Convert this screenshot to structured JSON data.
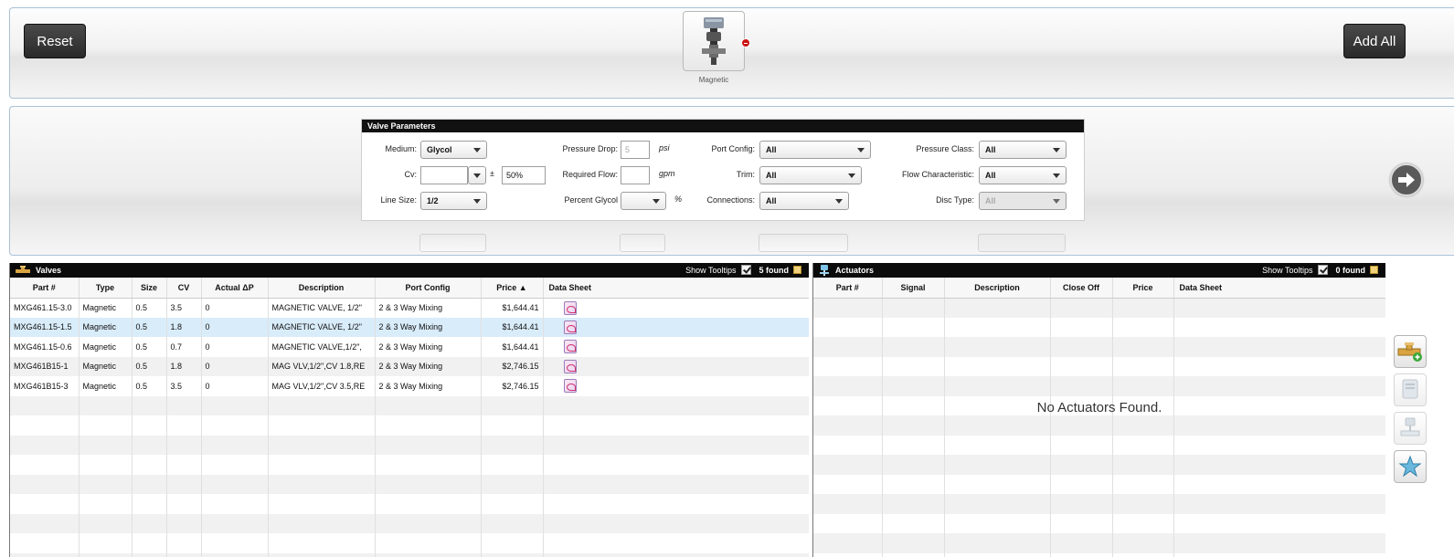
{
  "toolbar": {
    "reset_label": "Reset",
    "add_all_label": "Add All",
    "selected_valve_label": "Magnetic"
  },
  "params": {
    "title": "Valve Parameters",
    "medium_label": "Medium:",
    "medium_value": "Glycol",
    "cv_label": "Cv:",
    "cv_value": "",
    "plus_minus": "±",
    "cv_tolerance": "50%",
    "line_size_label": "Line Size:",
    "line_size_value": "1/2",
    "pressure_drop_label": "Pressure Drop:",
    "pressure_drop_placeholder": "5",
    "pressure_drop_unit": "psi",
    "required_flow_label": "Required Flow:",
    "required_flow_value": "",
    "required_flow_unit": "gpm",
    "percent_glycol_label": "Percent Glycol",
    "percent_glycol_value": "",
    "percent_unit": "%",
    "port_config_label": "Port Config:",
    "port_config_value": "All",
    "trim_label": "Trim:",
    "trim_value": "All",
    "connections_label": "Connections:",
    "connections_value": "All",
    "pressure_class_label": "Pressure Class:",
    "pressure_class_value": "All",
    "flow_char_label": "Flow Characteristic:",
    "flow_char_value": "All",
    "disc_type_label": "Disc Type:",
    "disc_type_value": "All"
  },
  "valves": {
    "title": "Valves",
    "show_tooltips_label": "Show Tooltips",
    "found_label": "5 found",
    "columns": [
      "Part #",
      "Type",
      "Size",
      "CV",
      "Actual ΔP",
      "Description",
      "Port Config",
      "Price ▲",
      "Data Sheet"
    ],
    "rows": [
      [
        "MXG461.15-3.0",
        "Magnetic",
        "0.5",
        "3.5",
        "0",
        "MAGNETIC VALVE, 1/2\"",
        "2 & 3 Way Mixing",
        "$1,644.41"
      ],
      [
        "MXG461.15-1.5",
        "Magnetic",
        "0.5",
        "1.8",
        "0",
        "MAGNETIC VALVE, 1/2\"",
        "2 & 3 Way Mixing",
        "$1,644.41"
      ],
      [
        "MXG461.15-0.6",
        "Magnetic",
        "0.5",
        "0.7",
        "0",
        "MAGNETIC VALVE,1/2\",",
        "2 & 3 Way Mixing",
        "$1,644.41"
      ],
      [
        "MXG461B15-1",
        "Magnetic",
        "0.5",
        "1.8",
        "0",
        "MAG VLV,1/2\",CV 1.8,RE",
        "2 & 3 Way Mixing",
        "$2,746.15"
      ],
      [
        "MXG461B15-3",
        "Magnetic",
        "0.5",
        "3.5",
        "0",
        "MAG VLV,1/2\",CV 3.5,RE",
        "2 & 3 Way Mixing",
        "$2,746.15"
      ]
    ],
    "selected_row": 1
  },
  "actuators": {
    "title": "Actuators",
    "show_tooltips_label": "Show Tooltips",
    "found_label": "0 found",
    "columns": [
      "Part #",
      "Signal",
      "Description",
      "Close Off",
      "Price",
      "Data Sheet"
    ],
    "empty_message": "No Actuators Found."
  },
  "colors": {
    "bar": "#0b0b0b",
    "selected_row": "#d9ecfa",
    "panel_border": "#a9c2d6"
  }
}
